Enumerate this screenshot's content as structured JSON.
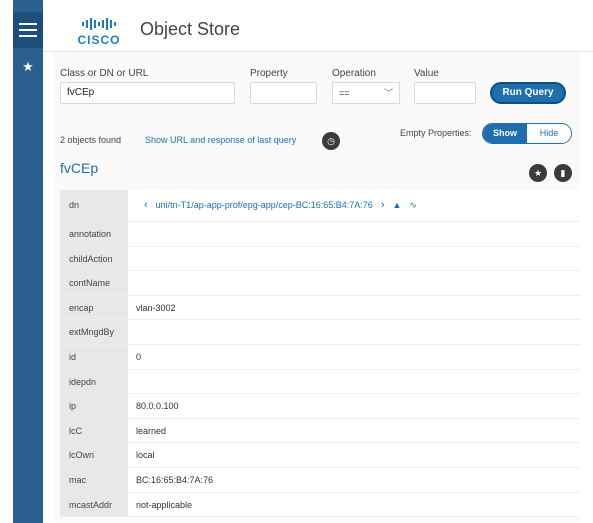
{
  "header": {
    "logo_text": "CISCO",
    "title": "Object Store"
  },
  "sidebar": {
    "menu_icon": "hamburger-icon",
    "star_icon": "star-icon"
  },
  "query": {
    "class_label": "Class or DN or URL",
    "class_value": "fvCEp",
    "property_label": "Property",
    "property_value": "",
    "operation_label": "Operation",
    "operation_value": "==",
    "value_label": "Value",
    "value_value": "",
    "run_button": "Run Query"
  },
  "results": {
    "count_text": "2 objects found",
    "show_url_link": "Show URL and response of last query",
    "empty_properties_label": "Empty Properties:",
    "toggle_show": "Show",
    "toggle_hide": "Hide",
    "class_name": "fvCEp"
  },
  "object": {
    "dn_key": "dn",
    "dn_value": "uni/tn-T1/ap-app-prof/epg-app/cep-BC:16:65:B4:7A:76",
    "rows": [
      {
        "key": "annotation",
        "value": ""
      },
      {
        "key": "childAction",
        "value": ""
      },
      {
        "key": "contName",
        "value": ""
      },
      {
        "key": "encap",
        "value": "vlan-3002"
      },
      {
        "key": "extMngdBy",
        "value": ""
      },
      {
        "key": "id",
        "value": "0"
      },
      {
        "key": "idepdn",
        "value": ""
      },
      {
        "key": "ip",
        "value": "80.0.0.100"
      },
      {
        "key": "lcC",
        "value": "learned"
      },
      {
        "key": "lcOwn",
        "value": "local"
      },
      {
        "key": "mac",
        "value": "BC:16:65:B4:7A:76"
      },
      {
        "key": "mcastAddr",
        "value": "not-applicable"
      }
    ]
  },
  "colors": {
    "sidebar": "#2a5f8f",
    "accent": "#1f6fae",
    "logo": "#1f7ec1"
  }
}
